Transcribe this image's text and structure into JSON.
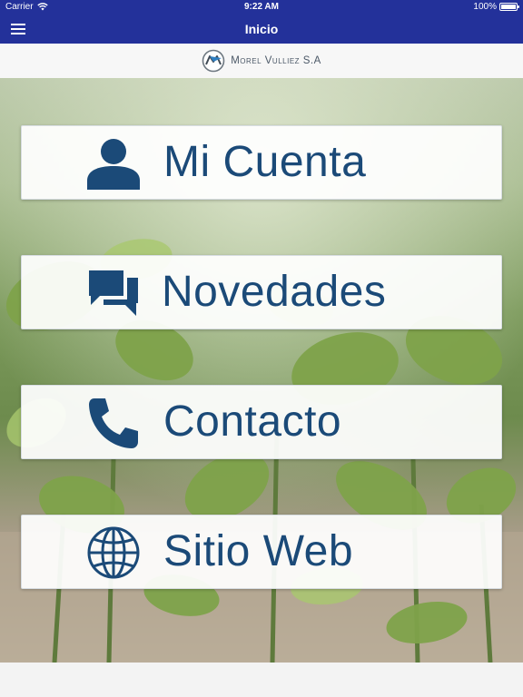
{
  "status_bar": {
    "carrier": "Carrier",
    "time": "9:22 AM",
    "battery": "100%",
    "battery_level": 1.0
  },
  "nav": {
    "title": "Inicio",
    "menu_icon": "hamburger-menu-icon"
  },
  "brand": {
    "name": "Morel Vulliez S.A",
    "logo_icon": "company-logo"
  },
  "menu_items": [
    {
      "label": "Mi Cuenta",
      "icon": "user-icon"
    },
    {
      "label": "Novedades",
      "icon": "chat-bubbles-icon"
    },
    {
      "label": "Contacto",
      "icon": "phone-icon"
    },
    {
      "label": "Sitio Web",
      "icon": "globe-icon"
    }
  ],
  "colors": {
    "nav_bar": "#23319a",
    "tile_text": "#1b4a78",
    "tile_background": "#ffffff"
  }
}
